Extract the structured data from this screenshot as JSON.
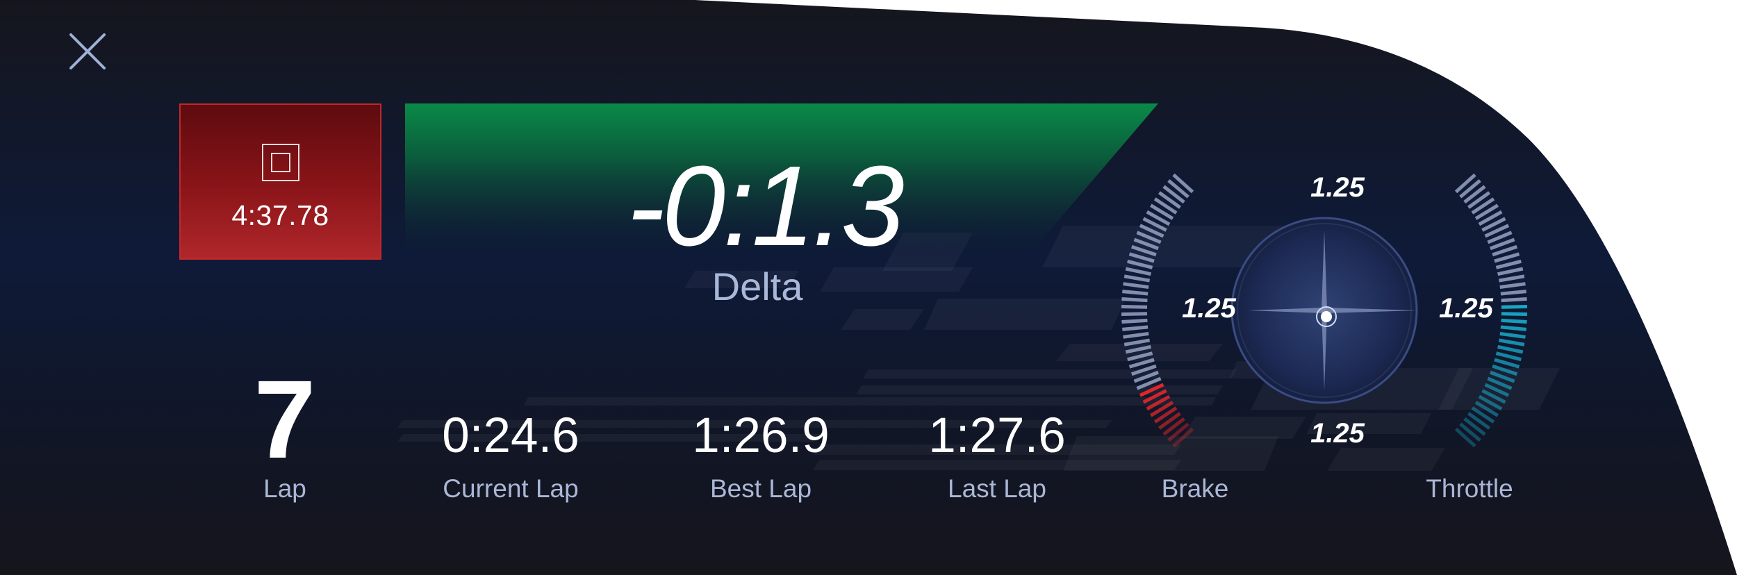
{
  "controls": {
    "close_icon": "close-icon"
  },
  "timer": {
    "session_time": "4:37.78",
    "state_icon": "stop-icon",
    "color": "#b0272b"
  },
  "delta": {
    "value": "-0:1.3",
    "label": "Delta",
    "color": "#0a8a48"
  },
  "laps": {
    "lap_number": "7",
    "lap_label": "Lap",
    "current_lap_value": "0:24.6",
    "current_lap_label": "Current Lap",
    "best_lap_value": "1:26.9",
    "best_lap_label": "Best Lap",
    "last_lap_value": "1:27.6",
    "last_lap_label": "Last Lap"
  },
  "g_meter": {
    "top": "1.25",
    "left": "1.25",
    "right": "1.25",
    "bottom": "1.25"
  },
  "pedals": {
    "brake_label": "Brake",
    "brake_level": 0.22,
    "brake_color": "#e0262b",
    "throttle_label": "Throttle",
    "throttle_level": 0.52,
    "throttle_color": "#19a6c4"
  }
}
